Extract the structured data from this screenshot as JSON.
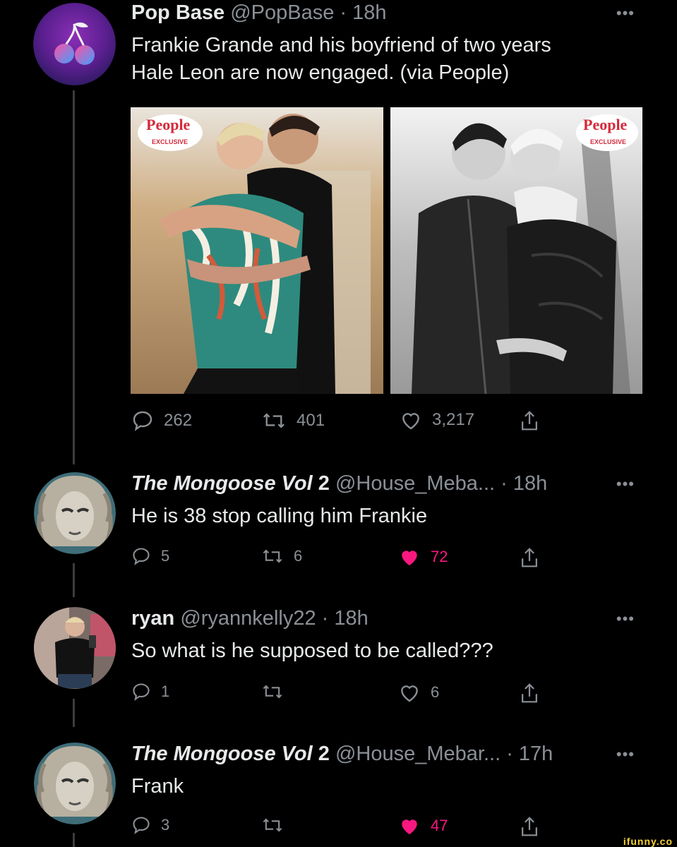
{
  "main_tweet": {
    "name": "Pop Base",
    "handle": "@PopBase",
    "time": "18h",
    "text_line1": "Frankie Grande and his boyfriend of two years",
    "text_line2": "Hale Leon are now engaged. (via People)",
    "badge_left": "People",
    "badge_left_sub": "EXCLUSIVE",
    "badge_right": "People",
    "badge_right_sub": "EXCLUSIVE",
    "replies": "262",
    "retweets": "401",
    "likes": "3,217"
  },
  "replies": [
    {
      "name": "The Mongoose Vol",
      "name_suffix": "2",
      "handle": "@House_Meba...",
      "time": "18h",
      "text": "He is 38 stop calling him Frankie",
      "replies": "5",
      "retweets": "6",
      "likes": "72",
      "liked": true
    },
    {
      "name": "ryan",
      "name_suffix": "",
      "handle": "@ryannkelly22",
      "time": "18h",
      "text": "So what is he supposed to be called???",
      "replies": "1",
      "retweets": "",
      "likes": "6",
      "liked": false
    },
    {
      "name": "The Mongoose Vol",
      "name_suffix": "2",
      "handle": "@House_Mebar...",
      "time": "17h",
      "text": "Frank",
      "replies": "3",
      "retweets": "",
      "likes": "47",
      "liked": true
    }
  ],
  "watermark": "ifunny.co",
  "colors": {
    "background": "#000000",
    "muted": "#8b9096",
    "like_pink": "#f91880",
    "line": "#3a3d40"
  },
  "icons": [
    "cherry-logo-icon",
    "reply-icon",
    "retweet-icon",
    "heart-icon",
    "share-icon",
    "more-icon"
  ]
}
